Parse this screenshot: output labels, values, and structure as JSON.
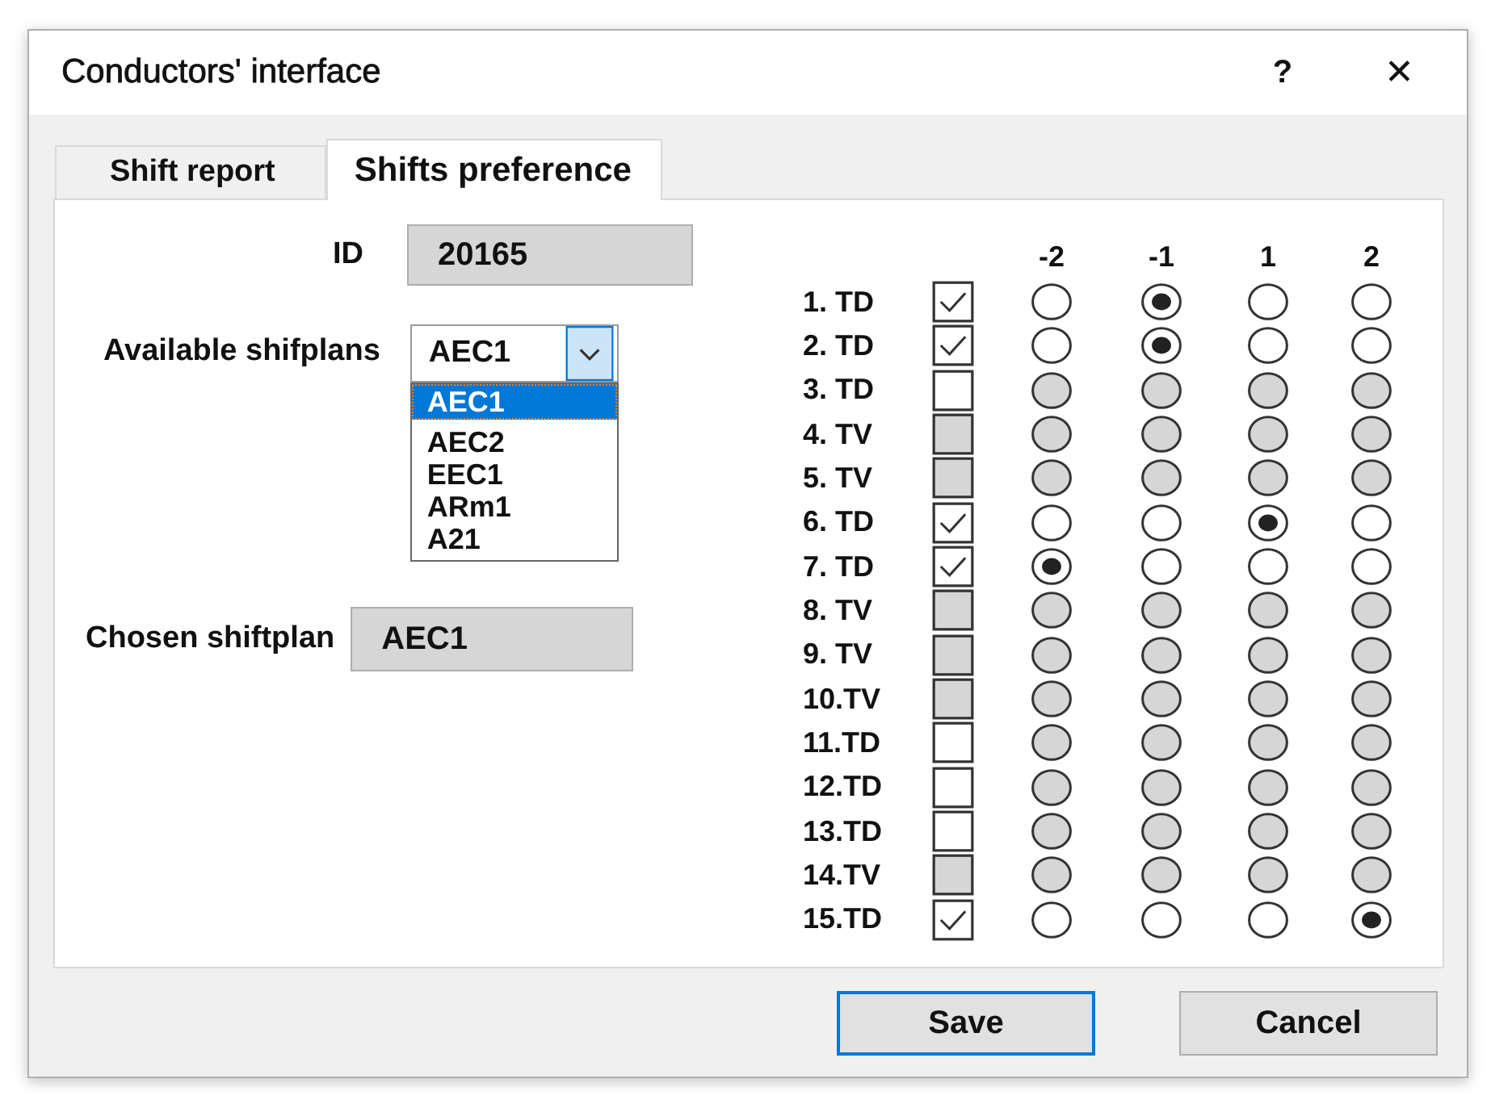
{
  "window": {
    "title": "Conductors' interface",
    "help": "?",
    "close": "✕"
  },
  "tabs": [
    {
      "label": "Shift report",
      "selected": false
    },
    {
      "label": "Shifts preference",
      "selected": true
    }
  ],
  "id_field": {
    "label": "ID",
    "value": "20165"
  },
  "shiftplans": {
    "label": "Available shifplans",
    "value": "AEC1",
    "expanded": true,
    "options": [
      {
        "label": "AEC1",
        "selected": true
      },
      {
        "label": "AEC2",
        "selected": false
      },
      {
        "label": "EEC1",
        "selected": false
      },
      {
        "label": "ARm1",
        "selected": false
      },
      {
        "label": "A21",
        "selected": false
      }
    ]
  },
  "chosen": {
    "label": "Chosen shiftplan",
    "value": "AEC1"
  },
  "preference": {
    "columns": [
      "-2",
      "-1",
      "1",
      "2"
    ],
    "rows": [
      {
        "label": "1. TD",
        "checked": true,
        "disabled": false,
        "options": [
          {
            "selected": false
          },
          {
            "selected": true
          },
          {
            "selected": false
          },
          {
            "selected": false
          }
        ]
      },
      {
        "label": "2. TD",
        "checked": true,
        "disabled": false,
        "options": [
          {
            "selected": false
          },
          {
            "selected": true
          },
          {
            "selected": false
          },
          {
            "selected": false
          }
        ]
      },
      {
        "label": "3. TD",
        "checked": false,
        "disabled": false,
        "options": [
          {
            "selected": false
          },
          {
            "selected": false
          },
          {
            "selected": false
          },
          {
            "selected": false
          }
        ]
      },
      {
        "label": "4. TV",
        "checked": false,
        "disabled": true,
        "options": [
          {
            "selected": false
          },
          {
            "selected": false
          },
          {
            "selected": false
          },
          {
            "selected": false
          }
        ]
      },
      {
        "label": "5. TV",
        "checked": false,
        "disabled": true,
        "options": [
          {
            "selected": false
          },
          {
            "selected": false
          },
          {
            "selected": false
          },
          {
            "selected": false
          }
        ]
      },
      {
        "label": "6. TD",
        "checked": true,
        "disabled": false,
        "options": [
          {
            "selected": false
          },
          {
            "selected": false
          },
          {
            "selected": true
          },
          {
            "selected": false
          }
        ]
      },
      {
        "label": "7. TD",
        "checked": true,
        "disabled": false,
        "options": [
          {
            "selected": true
          },
          {
            "selected": false
          },
          {
            "selected": false
          },
          {
            "selected": false
          }
        ]
      },
      {
        "label": "8. TV",
        "checked": false,
        "disabled": true,
        "options": [
          {
            "selected": false
          },
          {
            "selected": false
          },
          {
            "selected": false
          },
          {
            "selected": false
          }
        ]
      },
      {
        "label": "9. TV",
        "checked": false,
        "disabled": true,
        "options": [
          {
            "selected": false
          },
          {
            "selected": false
          },
          {
            "selected": false
          },
          {
            "selected": false
          }
        ]
      },
      {
        "label": "10.TV",
        "checked": false,
        "disabled": true,
        "options": [
          {
            "selected": false
          },
          {
            "selected": false
          },
          {
            "selected": false
          },
          {
            "selected": false
          }
        ]
      },
      {
        "label": "11.TD",
        "checked": false,
        "disabled": false,
        "options": [
          {
            "selected": false
          },
          {
            "selected": false
          },
          {
            "selected": false
          },
          {
            "selected": false
          }
        ]
      },
      {
        "label": "12.TD",
        "checked": false,
        "disabled": false,
        "options": [
          {
            "selected": false
          },
          {
            "selected": false
          },
          {
            "selected": false
          },
          {
            "selected": false
          }
        ]
      },
      {
        "label": "13.TD",
        "checked": false,
        "disabled": false,
        "options": [
          {
            "selected": false
          },
          {
            "selected": false
          },
          {
            "selected": false
          },
          {
            "selected": false
          }
        ]
      },
      {
        "label": "14.TV",
        "checked": false,
        "disabled": true,
        "options": [
          {
            "selected": false
          },
          {
            "selected": false
          },
          {
            "selected": false
          },
          {
            "selected": false
          }
        ]
      },
      {
        "label": "15.TD",
        "checked": true,
        "disabled": false,
        "options": [
          {
            "selected": false
          },
          {
            "selected": false
          },
          {
            "selected": false
          },
          {
            "selected": true
          }
        ]
      }
    ]
  },
  "buttons": [
    {
      "label": "Save",
      "kind": "default"
    },
    {
      "label": "Cancel",
      "kind": "normal"
    }
  ]
}
